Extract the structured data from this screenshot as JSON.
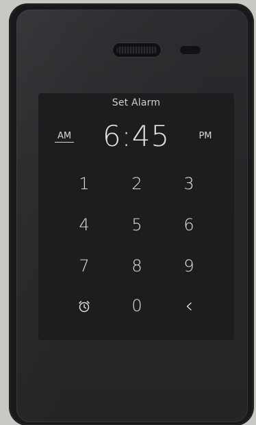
{
  "screen": {
    "title": "Set Alarm",
    "time": "6:45",
    "period_am": "AM",
    "period_pm": "PM",
    "selected_period": "AM"
  },
  "keypad": {
    "keys": [
      "1",
      "2",
      "3",
      "4",
      "5",
      "6",
      "7",
      "8",
      "9",
      "0"
    ],
    "alarm_icon": "alarm-clock-icon",
    "backspace_icon": "chevron-left-icon"
  },
  "colors": {
    "device_body": "#18191b",
    "screen_bg": "#1c1d1f",
    "text": "#dedfe1",
    "backdrop": "#c9c9c4"
  }
}
